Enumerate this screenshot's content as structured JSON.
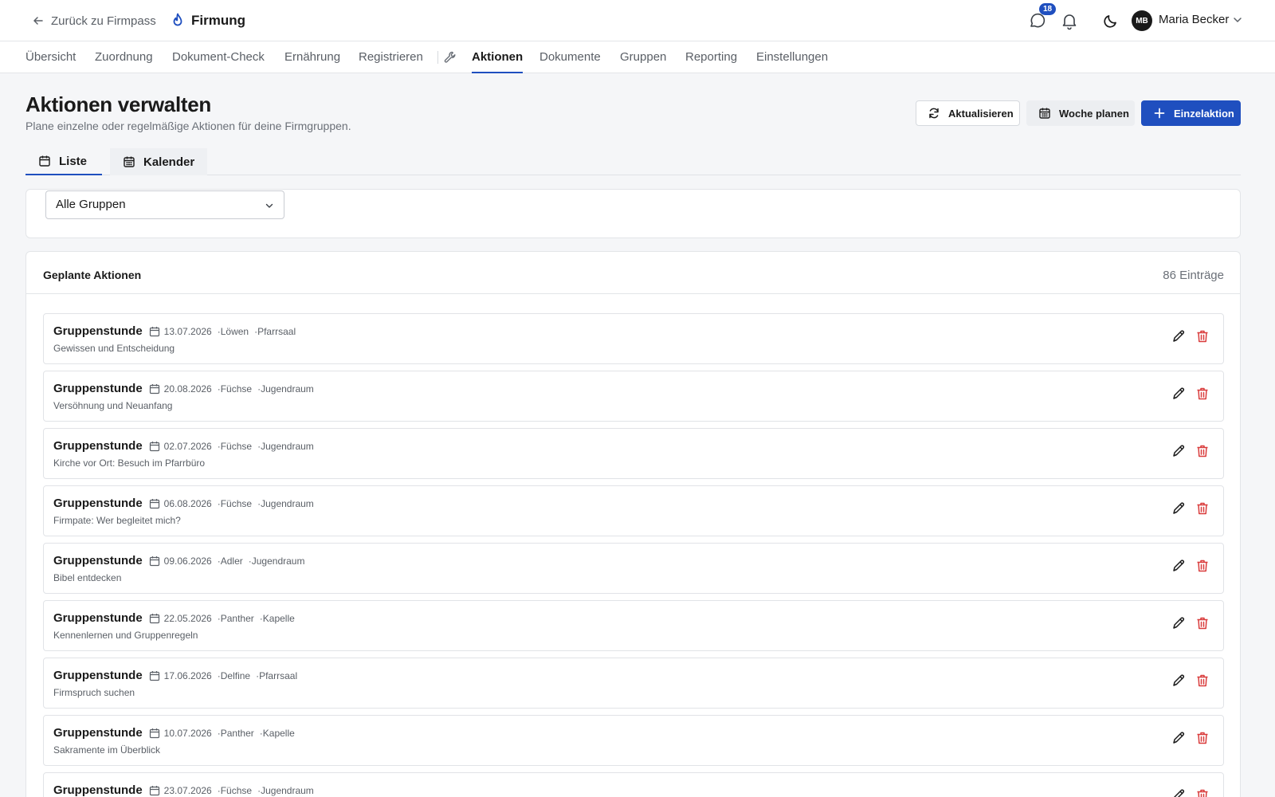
{
  "topbar": {
    "back_label": "Zurück zu Firmpass",
    "brand": "Firmung",
    "messages_badge": "18",
    "user_initials": "MB",
    "user_name": "Maria Becker"
  },
  "nav": {
    "items": [
      "Übersicht",
      "Zuordnung",
      "Dokument-Check",
      "Ernährung",
      "Registrieren",
      "Aktionen",
      "Dokumente",
      "Gruppen",
      "Reporting",
      "Einstellungen"
    ],
    "active": "Aktionen"
  },
  "header": {
    "title": "Aktionen verwalten",
    "subtitle": "Plane einzelne oder regelmäßige Aktionen für deine Firmgruppen."
  },
  "actions": {
    "refresh": "Aktualisieren",
    "plan_week": "Woche planen",
    "single_action": "Einzelaktion"
  },
  "tabs": {
    "list": "Liste",
    "calendar": "Kalender"
  },
  "filter": {
    "selected": "Alle Gruppen"
  },
  "list": {
    "title": "Geplante Aktionen",
    "count": "86 Einträge",
    "items": [
      {
        "title": "Gruppenstunde",
        "date": "13.07.2026",
        "group": "Löwen",
        "room": "Pfarrsaal",
        "topic": "Gewissen und Entscheidung"
      },
      {
        "title": "Gruppenstunde",
        "date": "20.08.2026",
        "group": "Füchse",
        "room": "Jugendraum",
        "topic": "Versöhnung und Neuanfang"
      },
      {
        "title": "Gruppenstunde",
        "date": "02.07.2026",
        "group": "Füchse",
        "room": "Jugendraum",
        "topic": "Kirche vor Ort: Besuch im Pfarrbüro"
      },
      {
        "title": "Gruppenstunde",
        "date": "06.08.2026",
        "group": "Füchse",
        "room": "Jugendraum",
        "topic": "Firmpate: Wer begleitet mich?"
      },
      {
        "title": "Gruppenstunde",
        "date": "09.06.2026",
        "group": "Adler",
        "room": "Jugendraum",
        "topic": "Bibel entdecken"
      },
      {
        "title": "Gruppenstunde",
        "date": "22.05.2026",
        "group": "Panther",
        "room": "Kapelle",
        "topic": "Kennenlernen und Gruppenregeln"
      },
      {
        "title": "Gruppenstunde",
        "date": "17.06.2026",
        "group": "Delfine",
        "room": "Pfarrsaal",
        "topic": "Firmspruch suchen"
      },
      {
        "title": "Gruppenstunde",
        "date": "10.07.2026",
        "group": "Panther",
        "room": "Kapelle",
        "topic": "Sakramente im Überblick"
      },
      {
        "title": "Gruppenstunde",
        "date": "23.07.2026",
        "group": "Füchse",
        "room": "Jugendraum",
        "topic": ""
      }
    ]
  },
  "colors": {
    "accent": "#1f4fbf",
    "danger": "#d93b3b"
  }
}
